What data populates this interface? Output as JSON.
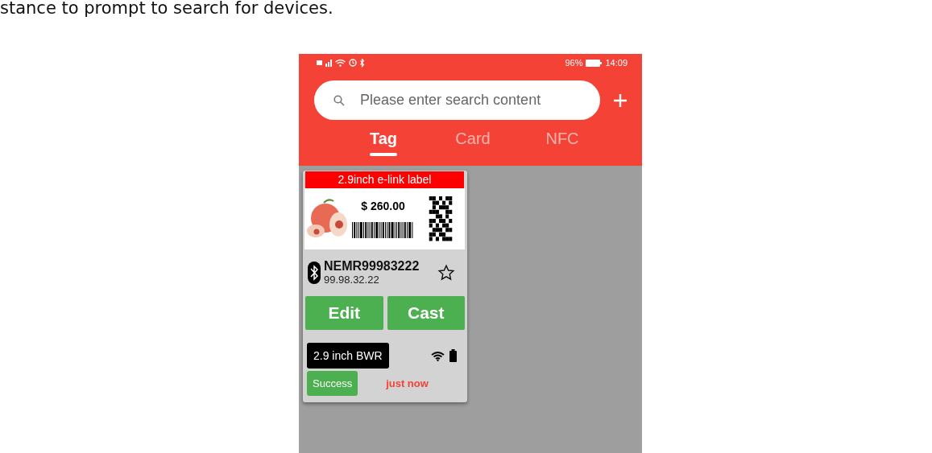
{
  "document_text": "stance to prompt to search for devices.",
  "status_bar": {
    "battery": "96%",
    "time": "14:09"
  },
  "search": {
    "placeholder": "Please enter search content"
  },
  "tabs": [
    {
      "label": "Tag",
      "selected": true
    },
    {
      "label": "Card",
      "selected": false
    },
    {
      "label": "NFC",
      "selected": false
    }
  ],
  "tags": [
    {
      "label_type": "2.9inch e-link label",
      "price": "$ 260.00",
      "name": "NEMR99983222",
      "address": "99.98.32.22",
      "favorite": false,
      "buttons": [
        "Edit",
        "Cast"
      ],
      "model": "2.9 inch BWR",
      "status": "Success",
      "time": "just now"
    }
  ]
}
